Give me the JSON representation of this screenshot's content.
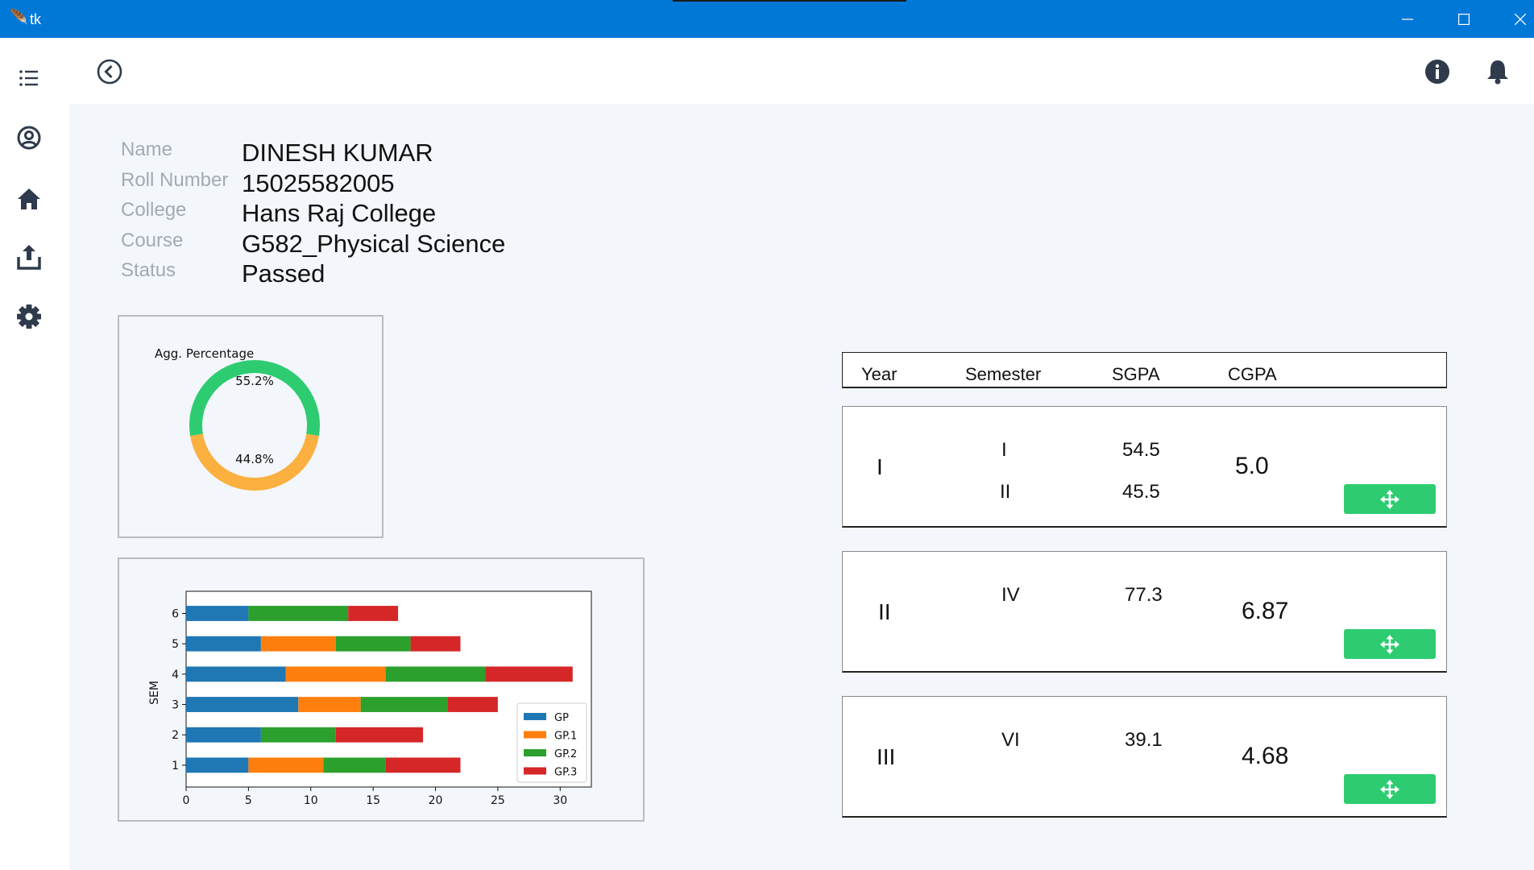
{
  "window": {
    "title": "tk"
  },
  "colors": {
    "titlebar": "#0078d7",
    "accent_green": "#2ecc71",
    "donut_green": "#2ecc71",
    "donut_orange": "#fbb040"
  },
  "sidebar": {
    "items": [
      "menu-icon",
      "profile-icon",
      "home-icon",
      "upload-icon",
      "settings-icon"
    ]
  },
  "header": {
    "icons": [
      "back-icon",
      "info-icon",
      "bell-icon"
    ]
  },
  "student": {
    "labels": {
      "name": "Name",
      "roll": "Roll Number",
      "college": "College",
      "course": "Course",
      "status": "Status"
    },
    "values": {
      "name": "DINESH KUMAR",
      "roll": "15025582005",
      "college": "Hans Raj College",
      "course": "G582_Physical Science",
      "status": "Passed"
    }
  },
  "table": {
    "headers": {
      "year": "Year",
      "semester": "Semester",
      "sgpa": "SGPA",
      "cgpa": "CGPA"
    },
    "rows": [
      {
        "year": "I",
        "semesters": [
          "I",
          "II"
        ],
        "sgpa": [
          "54.5",
          "45.5"
        ],
        "cgpa": "5.0"
      },
      {
        "year": "II",
        "semesters": [
          "IV"
        ],
        "sgpa": [
          "77.3"
        ],
        "cgpa": "6.87"
      },
      {
        "year": "III",
        "semesters": [
          "VI"
        ],
        "sgpa": [
          "39.1"
        ],
        "cgpa": "4.68"
      }
    ]
  },
  "chart_data": [
    {
      "type": "pie",
      "title": "Agg. Percentage",
      "slices": [
        {
          "label": "55.2%",
          "value": 55.2,
          "color": "#2ecc71"
        },
        {
          "label": "44.8%",
          "value": 44.8,
          "color": "#fbb040"
        }
      ]
    },
    {
      "type": "bar",
      "orientation": "horizontal",
      "stacked": true,
      "ylabel": "SEM",
      "categories": [
        "1",
        "2",
        "3",
        "4",
        "5",
        "6"
      ],
      "xlim": [
        0,
        32.5
      ],
      "xticks": [
        0,
        5,
        10,
        15,
        20,
        25,
        30
      ],
      "legend_position": "lower-right",
      "series": [
        {
          "name": "GP",
          "color": "#1f77b4",
          "values": [
            5,
            6,
            9,
            8,
            6,
            5
          ]
        },
        {
          "name": "GP.1",
          "color": "#ff7f0e",
          "values": [
            6,
            0,
            5,
            8,
            6,
            0
          ]
        },
        {
          "name": "GP.2",
          "color": "#2ca02c",
          "values": [
            5,
            6,
            7,
            8,
            6,
            8
          ]
        },
        {
          "name": "GP.3",
          "color": "#d62728",
          "values": [
            6,
            7,
            4,
            7,
            4,
            4
          ]
        }
      ]
    }
  ]
}
